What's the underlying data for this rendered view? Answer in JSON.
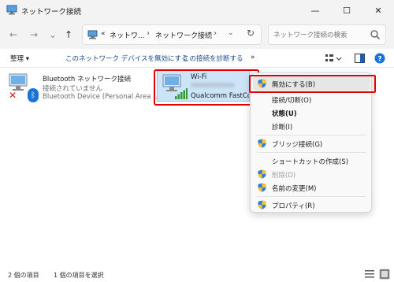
{
  "window": {
    "title": "ネットワーク接続",
    "minimize": "—",
    "maximize": "☐",
    "close": "✕"
  },
  "address": {
    "overflow": "«",
    "segments": [
      "ネットワ...",
      "ネットワーク接続"
    ],
    "separator": "›",
    "dropdown": "⌄",
    "refresh": "↻"
  },
  "search": {
    "placeholder": "ネットワーク接続の検索",
    "value": ""
  },
  "nav": {
    "back": "←",
    "forward": "→",
    "recent": "⌄",
    "up": "↑"
  },
  "commands": {
    "organize": "整理 ▾",
    "disable_device": "このネットワーク デバイスを無効にする",
    "diagnose": "この接続を診断する",
    "more": "»"
  },
  "items": [
    {
      "name": "Bluetooth ネットワーク接続",
      "status": "接続されていません",
      "device": "Bluetooth Device (Personal Area ...",
      "icon": "bluetooth-disconnected-icon"
    },
    {
      "name": "Wi-Fi",
      "device": "Qualcomm FastCon",
      "icon": "wifi-adapter-icon",
      "selected": true
    }
  ],
  "context_menu": {
    "items": [
      {
        "label": "無効にする(B)",
        "shield": true,
        "hover": true
      },
      {
        "label": "接続/切断(O)",
        "shield": false
      },
      {
        "label": "状態(U)",
        "shield": false,
        "bold": true
      },
      {
        "label": "診断(I)",
        "shield": false
      },
      {
        "label": "ブリッジ接続(G)",
        "shield": true
      },
      {
        "label": "ショートカットの作成(S)",
        "shield": false
      },
      {
        "label": "削除(D)",
        "shield": true,
        "disabled": true
      },
      {
        "label": "名前の変更(M)",
        "shield": true
      },
      {
        "label": "プロパティ(R)",
        "shield": true
      }
    ]
  },
  "status": {
    "count": "2 個の項目",
    "selected": "1 個の項目を選択"
  },
  "colors": {
    "highlight": "#e00000",
    "selection": "#cce4f7",
    "accent": "#0067c0"
  }
}
